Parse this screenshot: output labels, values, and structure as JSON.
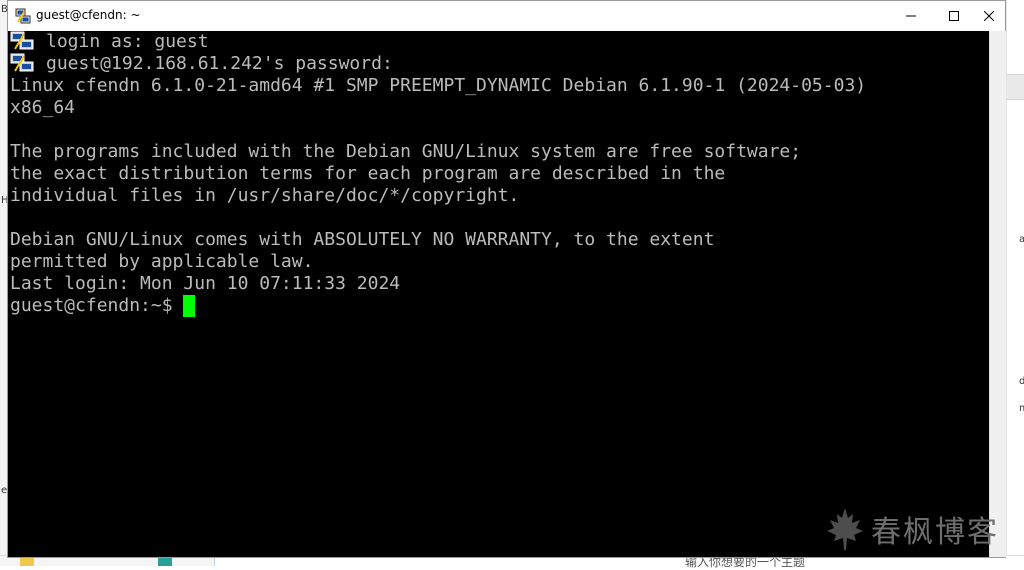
{
  "window": {
    "title": "guest@cfendn: ~"
  },
  "terminal": {
    "lines": [
      {
        "text": "login as: guest",
        "icon": "putty-terminal-icon"
      },
      {
        "text": "guest@192.168.61.242's password:",
        "icon": "putty-terminal-icon"
      },
      {
        "text": "Linux cfendn 6.1.0-21-amd64 #1 SMP PREEMPT_DYNAMIC Debian 6.1.90-1 (2024-05-03)"
      },
      {
        "text": "x86_64"
      },
      {
        "text": ""
      },
      {
        "text": "The programs included with the Debian GNU/Linux system are free software;"
      },
      {
        "text": "the exact distribution terms for each program are described in the"
      },
      {
        "text": "individual files in /usr/share/doc/*/copyright."
      },
      {
        "text": ""
      },
      {
        "text": "Debian GNU/Linux comes with ABSOLUTELY NO WARRANTY, to the extent"
      },
      {
        "text": "permitted by applicable law."
      },
      {
        "text": "Last login: Mon Jun 10 07:11:33 2024"
      },
      {
        "text": "guest@cfendn:~$ "
      }
    ],
    "cursor_color": "#00ff00",
    "text_color": "#bbbbbb",
    "background": "#000000"
  },
  "watermark": {
    "text": "春枫博客",
    "icon": "maple-leaf-icon"
  },
  "background_fragments": {
    "left": [
      "B",
      "H",
      "e"
    ],
    "right": [
      "a",
      "d",
      "m"
    ],
    "bottom_text": "输入你想要的一个主题"
  }
}
